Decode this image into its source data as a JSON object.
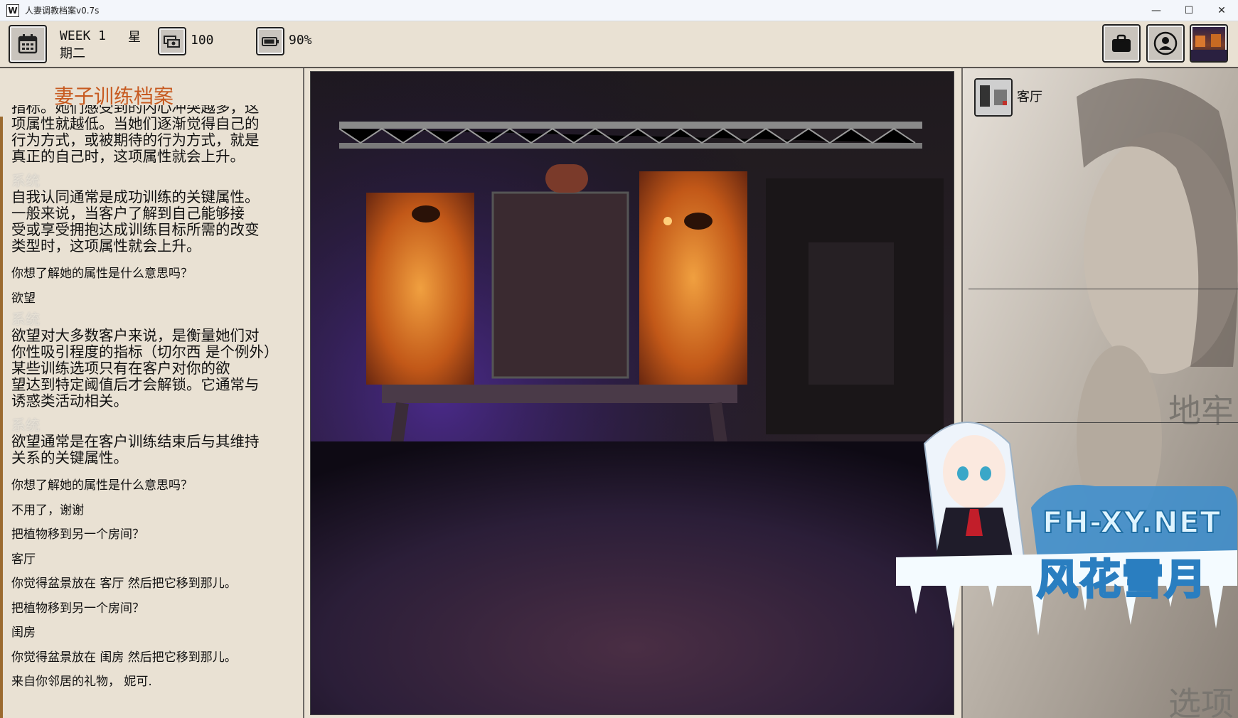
{
  "window": {
    "title": "人妻调教档案v0.7s",
    "app_icon": "W",
    "minimize": "—",
    "maximize": "☐",
    "close": "✕"
  },
  "hud": {
    "week": "WEEK 1",
    "day_char": "星",
    "day": "期二",
    "money": "100",
    "battery": "90%",
    "icons": [
      "calendar-icon",
      "money-icon",
      "battery-icon",
      "briefcase-icon",
      "contact-icon",
      "location-thumbnail"
    ]
  },
  "log": {
    "header": "妻子训练档案",
    "blocks": [
      {
        "type": "para",
        "lines": [
          "指标。她们感受到的内心冲突越多，这",
          "项属性就越低。当她们逐渐觉得自己的",
          "行为方式，或被期待的行为方式，就是",
          "真正的自己时，这项属性就会上升。"
        ]
      },
      {
        "type": "system",
        "label": "系统",
        "lines": [
          "自我认同通常是成功训练的关键属性。",
          "一般来说，当客户了解到自己能够接",
          "受或享受拥抱达成训练目标所需的改变",
          "类型时，这项属性就会上升。"
        ]
      },
      {
        "type": "line",
        "text": "你想了解她的属性是什么意思吗？"
      },
      {
        "type": "line",
        "text": "欲望"
      },
      {
        "type": "system",
        "label": "系统",
        "lines": [
          "欲望对大多数客户来说，是衡量她们对",
          "你性吸引程度的指标（切尔西    是个例外）",
          "某些训练选项只有在客户对你的欲",
          "望达到特定阈值后才会解锁。它通常与",
          "诱惑类活动相关。"
        ]
      },
      {
        "type": "system",
        "label": "系统",
        "lines": [
          "欲望通常是在客户训练结束后与其维持",
          "关系的关键属性。"
        ]
      },
      {
        "type": "line",
        "text": "你想了解她的属性是什么意思吗？"
      },
      {
        "type": "line",
        "text": "不用了，谢谢"
      },
      {
        "type": "line",
        "text": "把植物移到另一个房间？"
      },
      {
        "type": "line",
        "text": "客厅"
      },
      {
        "type": "line",
        "text": "你觉得盆景放在  客厅  然后把它移到那儿。"
      },
      {
        "type": "line",
        "text": "把植物移到另一个房间？"
      },
      {
        "type": "line",
        "text": "闺房"
      },
      {
        "type": "line",
        "text": "你觉得盆景放在  闺房  然后把它移到那儿。"
      },
      {
        "type": "line",
        "text": "来自你邻居的礼物，  妮可."
      }
    ]
  },
  "right": {
    "room": "客厅",
    "location": "地牢",
    "options": "选项"
  },
  "watermark": {
    "site": "FH-XY.NET",
    "name": "风花雪月"
  },
  "colors": {
    "panel_bg": "#e9e1d3",
    "header_orange": "#c75a20",
    "accent_bar": "#9b6a2f"
  }
}
